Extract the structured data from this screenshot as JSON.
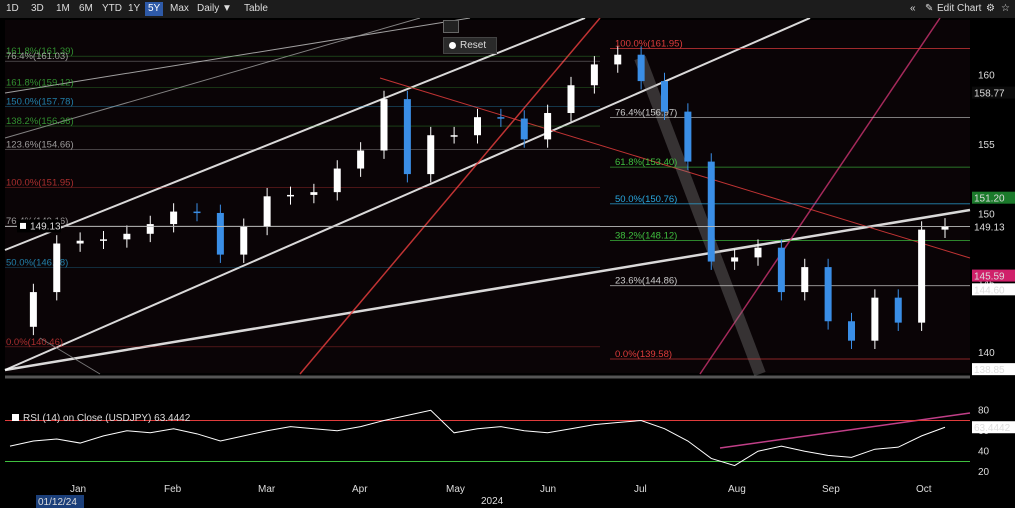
{
  "toolbar": {
    "ranges": [
      "1D",
      "3D",
      "1M",
      "6M",
      "YTD",
      "1Y",
      "5Y",
      "Max"
    ],
    "active_range": "5Y",
    "frequency": "Daily",
    "table_label": "Table",
    "edit_chart": "Edit Chart",
    "nav_icons": [
      "double-chevron-left-icon",
      "edit-icon",
      "gear-icon",
      "star-icon"
    ]
  },
  "reset_label": "Reset",
  "chart_data": [
    {
      "type": "candlestick",
      "instrument": "USDJPY",
      "xlabel": "2024",
      "months": [
        "Jan",
        "Feb",
        "Mar",
        "Apr",
        "May",
        "Jun",
        "Jul",
        "Aug",
        "Sep",
        "Oct"
      ],
      "ylim": [
        138.5,
        164
      ],
      "y_ticks": [
        140,
        145,
        150,
        155,
        160
      ],
      "closes_weekly": [
        {
          "w": 0,
          "c": 141.9
        },
        {
          "w": 1,
          "c": 144.4
        },
        {
          "w": 2,
          "c": 147.9
        },
        {
          "w": 3,
          "c": 148.1
        },
        {
          "w": 4,
          "c": 148.2
        },
        {
          "w": 5,
          "c": 148.6
        },
        {
          "w": 6,
          "c": 149.3
        },
        {
          "w": 7,
          "c": 150.2
        },
        {
          "w": 8,
          "c": 150.1
        },
        {
          "w": 9,
          "c": 147.1
        },
        {
          "w": 10,
          "c": 149.1
        },
        {
          "w": 11,
          "c": 151.3
        },
        {
          "w": 12,
          "c": 151.4
        },
        {
          "w": 13,
          "c": 151.6
        },
        {
          "w": 14,
          "c": 153.3
        },
        {
          "w": 15,
          "c": 154.6
        },
        {
          "w": 16,
          "c": 158.3
        },
        {
          "w": 17,
          "c": 152.9
        },
        {
          "w": 18,
          "c": 155.7
        },
        {
          "w": 19,
          "c": 155.7
        },
        {
          "w": 20,
          "c": 157.0
        },
        {
          "w": 21,
          "c": 156.9
        },
        {
          "w": 22,
          "c": 155.4
        },
        {
          "w": 23,
          "c": 157.3
        },
        {
          "w": 24,
          "c": 159.3
        },
        {
          "w": 25,
          "c": 160.8
        },
        {
          "w": 26,
          "c": 161.5
        },
        {
          "w": 27,
          "c": 159.6
        },
        {
          "w": 28,
          "c": 157.4
        },
        {
          "w": 29,
          "c": 153.8
        },
        {
          "w": 30,
          "c": 146.6
        },
        {
          "w": 31,
          "c": 146.9
        },
        {
          "w": 32,
          "c": 147.6
        },
        {
          "w": 33,
          "c": 144.4
        },
        {
          "w": 34,
          "c": 146.2
        },
        {
          "w": 35,
          "c": 142.3
        },
        {
          "w": 36,
          "c": 140.9
        },
        {
          "w": 37,
          "c": 144.0
        },
        {
          "w": 38,
          "c": 142.2
        },
        {
          "w": 39,
          "c": 148.9
        },
        {
          "w": 40,
          "c": 149.13
        }
      ],
      "right_axis_labels": [
        {
          "value": 158.77,
          "text": "158.77",
          "bg": "#0b0b0b",
          "fg": "#7fb0d0"
        },
        {
          "value": 151.2,
          "text": "151.20",
          "bg": "#1b7a2b",
          "fg": "#ffffff"
        },
        {
          "value": 149.13,
          "text": "149.13",
          "bg": "#000000",
          "fg": "#ffffff"
        },
        {
          "value": 145.59,
          "text": "145.59",
          "bg": "#d0206a",
          "fg": "#ffffff"
        },
        {
          "value": 144.6,
          "text": "144.60",
          "bg": "#ffffff",
          "fg": "#000000"
        },
        {
          "value": 138.85,
          "text": "138.85",
          "bg": "#ffffff",
          "fg": "#000000"
        }
      ],
      "last_price_label": "149.13",
      "fib_levels": [
        {
          "text": "100.0%(161.95)",
          "value": 161.95,
          "color": "#e03c3c"
        },
        {
          "text": "76.4%(156.97)",
          "value": 156.97,
          "color": "#cccccc"
        },
        {
          "text": "61.8%(153.40)",
          "value": 153.4,
          "color": "#3fbf3f"
        },
        {
          "text": "50.0%(150.76)",
          "value": 150.76,
          "color": "#29a8e0"
        },
        {
          "text": "38.2%(148.12)",
          "value": 148.12,
          "color": "#3fbf3f"
        },
        {
          "text": "23.6%(144.86)",
          "value": 144.86,
          "color": "#cccccc"
        },
        {
          "text": "0.0%(139.58)",
          "value": 139.58,
          "color": "#e03c3c"
        }
      ],
      "fib_levels_left": [
        {
          "text": "161.8%(161.39)",
          "value": 161.39,
          "color": "#3fbf3f"
        },
        {
          "text": "76.4%(161.03)",
          "value": 161.03,
          "color": "#cccccc"
        },
        {
          "text": "161.8%(159.12)",
          "value": 159.12,
          "color": "#3fbf3f"
        },
        {
          "text": "150.0%(157.78)",
          "value": 157.78,
          "color": "#29a8e0"
        },
        {
          "text": "138.2%(156.36)",
          "value": 156.36,
          "color": "#3fbf3f"
        },
        {
          "text": "123.6%(154.66)",
          "value": 154.66,
          "color": "#cccccc"
        },
        {
          "text": "100.0%(151.95)",
          "value": 151.95,
          "color": "#e03c3c"
        },
        {
          "text": "76.4%(149.16)",
          "value": 149.16,
          "color": "#cccccc"
        },
        {
          "text": "50.0%(146.18)",
          "value": 146.18,
          "color": "#29a8e0"
        },
        {
          "text": "0.0%(140.46)",
          "value": 140.46,
          "color": "#e03c3c"
        }
      ]
    },
    {
      "type": "line",
      "title": "RSI (14) on Close (USDJPY) 63.4442",
      "ylim": [
        10,
        90
      ],
      "y_ticks": [
        20,
        40,
        60,
        80
      ],
      "overbought": 70,
      "oversold": 30,
      "last_value_label": "63.4442",
      "values": [
        45,
        50,
        52,
        48,
        55,
        60,
        58,
        62,
        57,
        50,
        55,
        60,
        64,
        62,
        60,
        64,
        70,
        75,
        80,
        58,
        62,
        64,
        60,
        58,
        62,
        66,
        68,
        70,
        62,
        50,
        33,
        26,
        40,
        45,
        40,
        36,
        34,
        42,
        44,
        55,
        63.44
      ]
    }
  ],
  "date_cursor_label": "01/12/24"
}
